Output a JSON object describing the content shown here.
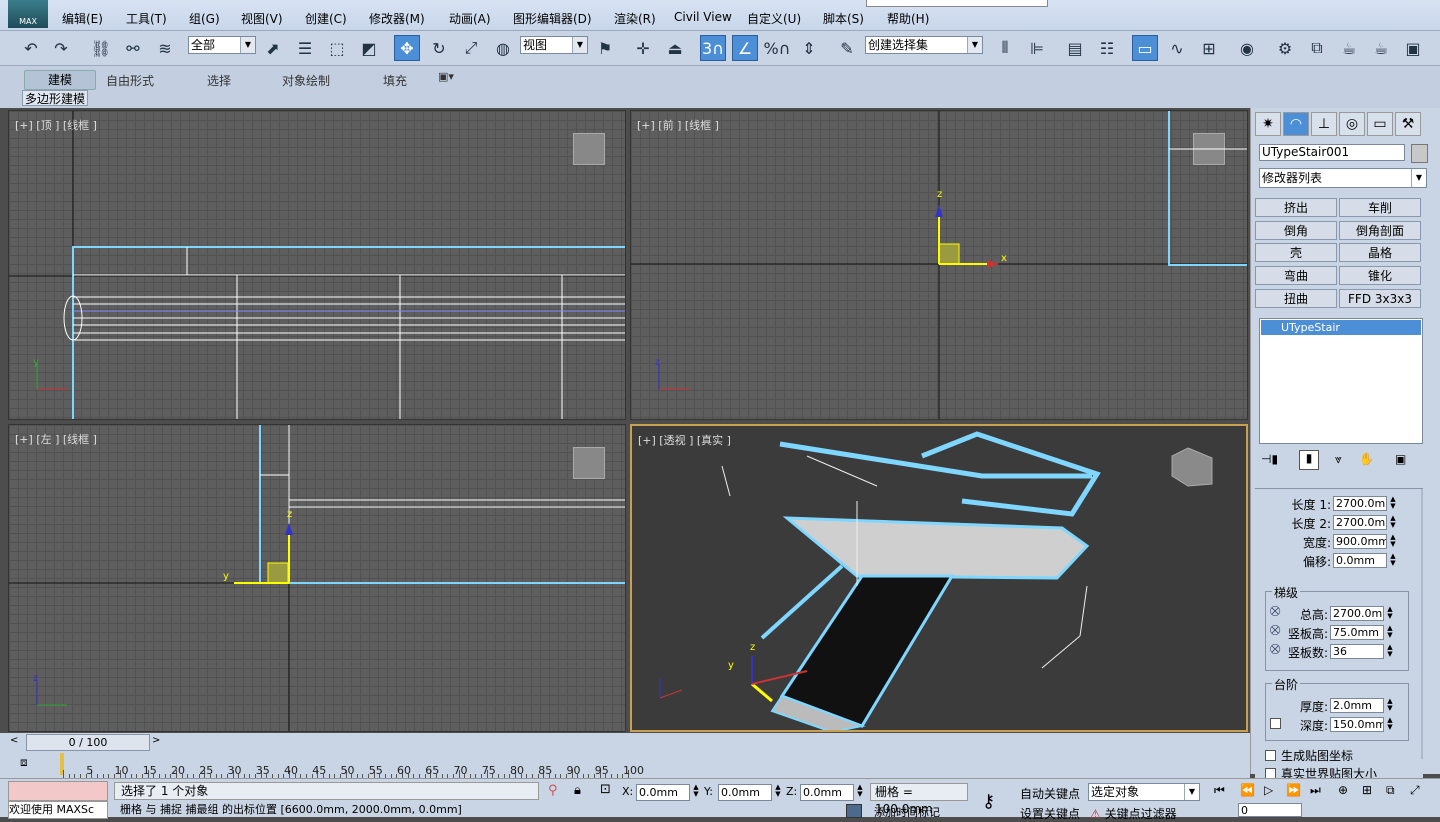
{
  "menu": {
    "logo_text": "MAX",
    "items": [
      "编辑(E)",
      "工具(T)",
      "组(G)",
      "视图(V)",
      "创建(C)",
      "修改器(M)",
      "动画(A)",
      "图形编辑器(D)",
      "渲染(R)",
      "Civil View",
      "自定义(U)",
      "脚本(S)",
      "帮助(H)"
    ]
  },
  "toolbar": {
    "filter_select": "全部",
    "coord_select": "视图",
    "named_set_select": "创建选择集",
    "snap_label": "3",
    "angle_snap_label": "%"
  },
  "ribbon": {
    "tabs": [
      "建模",
      "自由形式",
      "选择",
      "对象绘制",
      "填充"
    ],
    "sub_label": "多边形建模"
  },
  "viewports": {
    "top": "[+] [顶 ] [线框 ]",
    "front": "[+] [前 ] [线框 ]",
    "left": "[+] [左 ] [线框 ]",
    "persp": "[+] [透视 ] [真实 ]"
  },
  "axes": {
    "x": "x",
    "y": "y",
    "z": "z"
  },
  "panel": {
    "object_name": "UTypeStair001",
    "modifier_list": "修改器列表",
    "buttons": [
      "挤出",
      "车削",
      "倒角",
      "倒角剖面",
      "壳",
      "晶格",
      "弯曲",
      "锥化",
      "扭曲",
      "FFD 3x3x3"
    ],
    "stack_item": "UTypeStair",
    "params": {
      "length1_label": "长度 1:",
      "length1": "2700.0mm",
      "length2_label": "长度 2:",
      "length2": "2700.0mm",
      "width_label": "宽度:",
      "width": "900.0mm",
      "offset_label": "偏移:",
      "offset": "0.0mm"
    },
    "steps": {
      "title": "梯级",
      "total_label": "总高:",
      "total": "2700.0mm",
      "riser_h_label": "竖板高:",
      "riser_h": "75.0mm",
      "riser_count_label": "竖板数:",
      "riser_count": "36"
    },
    "treads": {
      "title": "台阶",
      "thick_label": "厚度:",
      "thick": "2.0mm",
      "depth_label": "深度:",
      "depth": "150.0mm"
    },
    "gen_map": "生成贴图坐标",
    "real_world": "真实世界贴图大小"
  },
  "timeline": {
    "frame": "0 / 100",
    "ticks": [
      "5",
      "10",
      "15",
      "20",
      "25",
      "30",
      "35",
      "40",
      "45",
      "50",
      "55",
      "60",
      "65",
      "70",
      "75",
      "80",
      "85",
      "90",
      "95",
      "100"
    ]
  },
  "status": {
    "welcome": "欢迎使用 MAXSc",
    "selected": "选择了 1 个对象",
    "x_label": "X:",
    "x": "0.0mm",
    "y_label": "Y:",
    "y": "0.0mm",
    "z_label": "Z:",
    "z": "0.0mm",
    "grid": "栅格 = 100.0mm",
    "autokey": "自动关键点",
    "setkey": "设置关键点",
    "selobj": "选定对象",
    "keyfilter": "关键点过滤器",
    "prompt": "栅格 与 捕捉 捕最组 的出标位置",
    "prompt_coords": "[6600.0mm, 2000.0mm, 0.0mm]",
    "add_time_tag": "添加时间标记",
    "frame_field": "0"
  },
  "colors": {
    "accent": "#4d8fd6",
    "wire": "#7fd6ff",
    "selected_border": "#c8a050"
  }
}
